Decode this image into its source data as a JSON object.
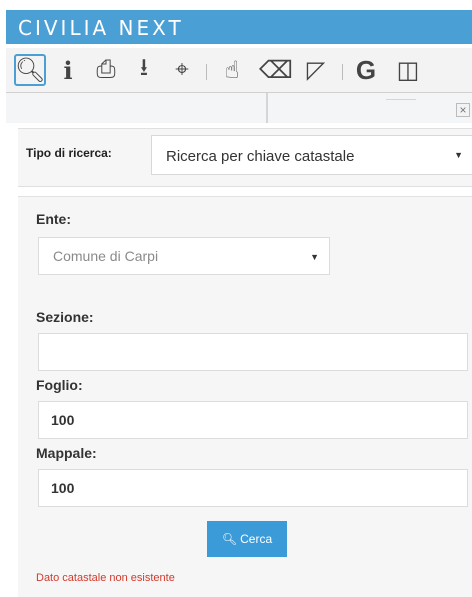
{
  "app": {
    "title": "CIVILIA NEXT",
    "accent_color": "#4a9fd4"
  },
  "toolbar": {
    "tools": [
      {
        "icon": "search-icon",
        "glyph": "🔍︎",
        "active": true
      },
      {
        "icon": "info-icon",
        "glyph": "i"
      },
      {
        "icon": "print-icon",
        "glyph": "⎙"
      },
      {
        "icon": "download-icon",
        "glyph": "⭳"
      },
      {
        "icon": "locate-icon",
        "glyph": "⌖"
      },
      {
        "icon": "hand-pointer-icon",
        "glyph": "☝"
      },
      {
        "icon": "eraser-icon",
        "glyph": "⌫"
      },
      {
        "icon": "corner-icon",
        "glyph": "◸"
      },
      {
        "icon": "google-icon",
        "glyph": "G"
      },
      {
        "icon": "split-view-icon",
        "glyph": "◫"
      }
    ]
  },
  "close_label": "×",
  "search_type": {
    "label": "Tipo di ricerca:",
    "selected": "Ricerca per chiave catastale"
  },
  "form": {
    "ente_label": "Ente:",
    "ente_selected": "Comune di Carpi",
    "sezione_label": "Sezione:",
    "sezione_value": "",
    "foglio_label": "Foglio:",
    "foglio_value": "100",
    "mappale_label": "Mappale:",
    "mappale_value": "100",
    "search_button": "Cerca",
    "error_message": "Dato catastale non esistente"
  }
}
